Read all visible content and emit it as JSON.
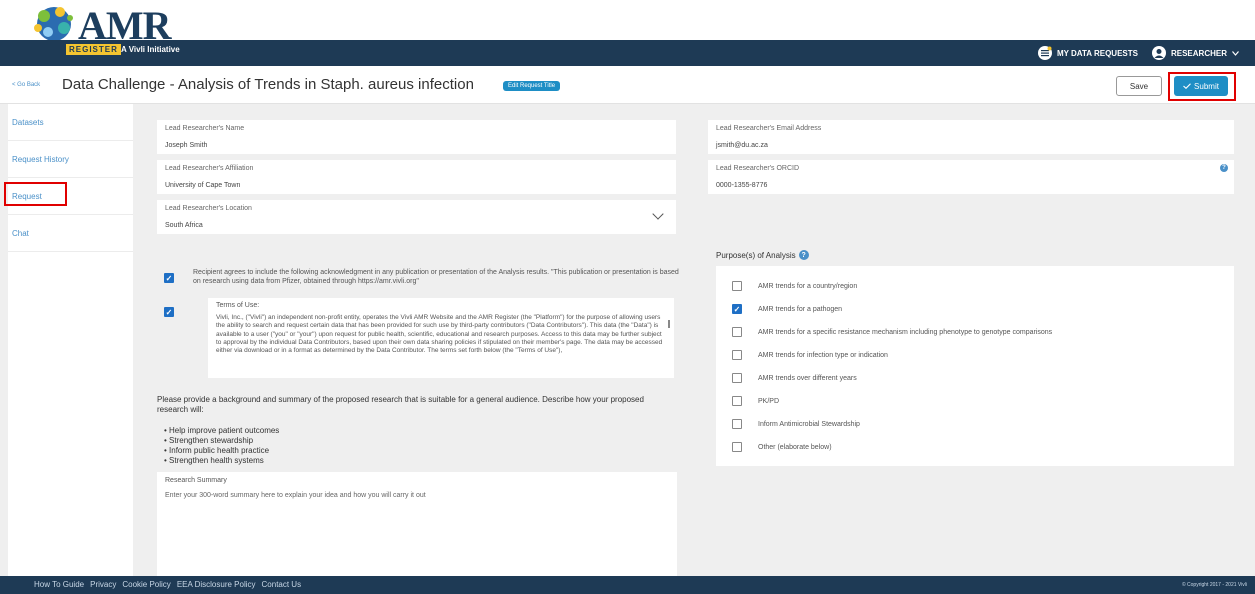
{
  "brand": {
    "logo_text": "AMR",
    "register_tag": "REGISTER",
    "initiative": "A Vivli Initiative",
    "colors": {
      "navy": "#1e3a55",
      "accent": "#1e8ec5",
      "highlight": "#e00000",
      "tag": "#f4c430"
    }
  },
  "topnav": {
    "data_requests": "MY DATA REQUESTS",
    "user": "RESEARCHER",
    "icons": [
      "data-requests-icon",
      "user-avatar-icon",
      "chevron-down-icon"
    ]
  },
  "header": {
    "go_back": "< Go Back",
    "title": "Data Challenge - Analysis of Trends in Staph. aureus infection",
    "edit_title": "Edit Request Title",
    "save": "Save",
    "submit": "Submit"
  },
  "sidebar": {
    "items": [
      {
        "label": "Datasets"
      },
      {
        "label": "Request History"
      },
      {
        "label": "Request"
      },
      {
        "label": "Chat"
      }
    ]
  },
  "form": {
    "name_label": "Lead Researcher's Name",
    "name_value": "Joseph Smith",
    "affiliation_label": "Lead Researcher's Affiliation",
    "affiliation_value": "University of Cape Town",
    "location_label": "Lead Researcher's Location",
    "location_value": "South Africa",
    "email_label": "Lead Researcher's Email Address",
    "email_value": "jsmith@du.ac.za",
    "orcid_label": "Lead Researcher's ORCID",
    "orcid_value": "0000-1355-8776"
  },
  "agreement": {
    "ack_checked": true,
    "ack_text": "Recipient agrees to include the following acknowledgment in any publication or presentation of the Analysis results. \"This publication or presentation is based on research using data from Pfizer, obtained through https://amr.vivli.org\"",
    "terms_checked": true,
    "terms_title": "Terms of Use:",
    "terms_body": "Vivli, Inc., (\"Vivli\") an independent non-profit entity, operates the Vivli AMR Website and the AMR Register (the \"Platform\") for the purpose of allowing users the ability to search and request certain data that has been provided for such use by third-party contributors (\"Data Contributors\"). This data (the \"Data\") is available to a user (\"you\" or \"your\") upon request for public health, scientific, educational and research purposes. Access to this data may be further subject to approval by the individual Data Contributors, based upon their own data sharing policies if stipulated on their member's page. The data may be accessed either via download or in a format as determined by the Data Contributor. The terms set forth below (the \"Terms of Use\"),"
  },
  "research": {
    "prompt": "Please provide a background and summary of the proposed research that is suitable for a general audience. Describe how your proposed research will:",
    "bullets": [
      "Help improve patient outcomes",
      "Strengthen stewardship",
      "Inform public health practice",
      "Strengthen health systems"
    ],
    "summary_label": "Research Summary",
    "summary_placeholder": "Enter your 300-word summary here to explain your idea and how you will carry it out"
  },
  "purpose": {
    "title": "Purpose(s) of Analysis",
    "options": [
      {
        "label": "AMR trends for a country/region",
        "checked": false
      },
      {
        "label": "AMR trends for a pathogen",
        "checked": true
      },
      {
        "label": "AMR trends for a specific resistance mechanism including phenotype to genotype comparisons",
        "checked": false
      },
      {
        "label": "AMR trends for infection type or indication",
        "checked": false
      },
      {
        "label": "AMR trends over different years",
        "checked": false
      },
      {
        "label": "PK/PD",
        "checked": false
      },
      {
        "label": "Inform Antimicrobial Stewardship",
        "checked": false
      },
      {
        "label": "Other (elaborate below)",
        "checked": false
      }
    ]
  },
  "footer": {
    "links": [
      "How To Guide",
      "Privacy",
      "Cookie Policy",
      "EEA Disclosure Policy",
      "Contact Us"
    ],
    "copyright": "© Copyright 2017 - 2021 Vivli"
  }
}
